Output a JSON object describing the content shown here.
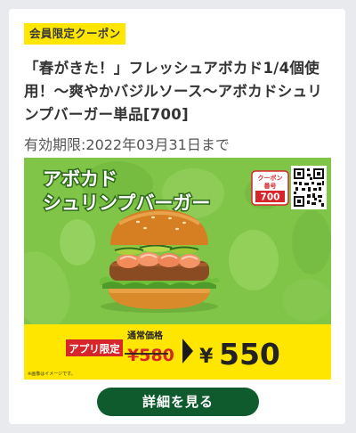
{
  "coupon": {
    "badge": "会員限定クーポン",
    "title": "「春がきた！」フレッシュアボカド1/4個使用！〜爽やかバジルソース〜アボカドシュリンプバーガー単品[700]",
    "validity": "有効期限:2022年03月31日まで"
  },
  "banner": {
    "product_line1": "アボカド",
    "product_line2": "シュリンプバーガー",
    "coupon_label_line1": "クーポン",
    "coupon_label_line2": "番号",
    "coupon_number": "700",
    "app_only_label": "アプリ限定",
    "regular_price_label": "通常価格",
    "regular_price": "¥580",
    "sale_price_yen": "¥",
    "sale_price": "550",
    "image_note": "※画像はイメージです。"
  },
  "actions": {
    "detail_button": "詳細を見る"
  },
  "colors": {
    "accent_green": "#0f5b2e",
    "badge_yellow": "#ffe600",
    "banner_green": "#80c548",
    "price_red": "#d6262b"
  }
}
